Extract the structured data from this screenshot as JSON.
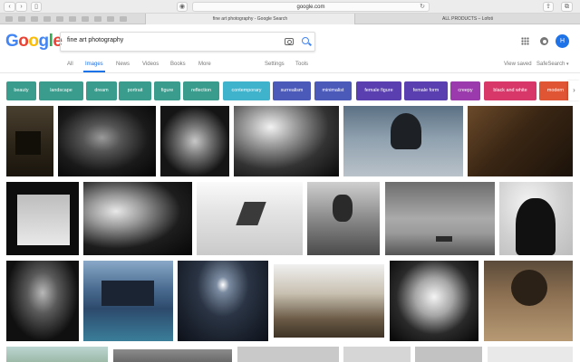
{
  "browser": {
    "address": "google.com",
    "tabs": [
      {
        "label": "fine art photography - Google Search"
      },
      {
        "label": "ALL PRODUCTS – Lofoti"
      }
    ]
  },
  "search": {
    "query": "fine art photography"
  },
  "user": {
    "initial": "H"
  },
  "nav": {
    "all": "All",
    "images": "Images",
    "news": "News",
    "videos": "Videos",
    "books": "Books",
    "more": "More",
    "settings": "Settings",
    "tools": "Tools",
    "view_saved": "View saved",
    "safesearch": "SafeSearch"
  },
  "chips": [
    {
      "label": "beauty",
      "color": "#3a9c8c"
    },
    {
      "label": "landscape",
      "color": "#3a9c8c"
    },
    {
      "label": "dream",
      "color": "#3a9c8c"
    },
    {
      "label": "portrait",
      "color": "#3a9c8c"
    },
    {
      "label": "figure",
      "color": "#3a9c8c"
    },
    {
      "label": "reflection",
      "color": "#3a9c8c"
    },
    {
      "label": "contemporary",
      "color": "#3fb2cc"
    },
    {
      "label": "surrealism",
      "color": "#4b59b8"
    },
    {
      "label": "minimalist",
      "color": "#4b59b8"
    },
    {
      "label": "female figure",
      "color": "#5a3fb0"
    },
    {
      "label": "female form",
      "color": "#5a3fb0"
    },
    {
      "label": "creepy",
      "color": "#9b3aad"
    },
    {
      "label": "black and white",
      "color": "#d8376a"
    },
    {
      "label": "modern",
      "color": "#e05534"
    }
  ],
  "colors": {
    "link_blue": "#1a73e8",
    "google_blue": "#4285F4",
    "google_red": "#EA4335",
    "google_yellow": "#FBBC05",
    "google_green": "#34A853"
  }
}
